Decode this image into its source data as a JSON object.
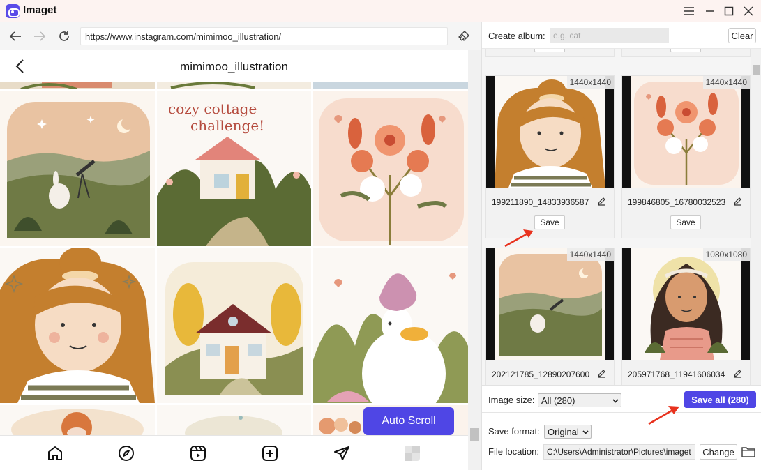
{
  "app": {
    "title": "Imaget"
  },
  "browser": {
    "url": "https://www.instagram.com/mimimoo_illustration/"
  },
  "instagram": {
    "profile_name": "mimimoo_illustration",
    "grid_texts": {
      "cozy_line1": "cozy cottage",
      "cozy_line2": "challenge!"
    },
    "auto_scroll_label": "Auto Scroll",
    "bottom_nav": [
      "home-icon",
      "explore-icon",
      "reels-icon",
      "create-icon",
      "direct-icon",
      "profile-icon"
    ]
  },
  "panel": {
    "album_label": "Create album:",
    "album_placeholder": "e.g. cat",
    "clear_label": "Clear",
    "save_label": "Save",
    "cards": [
      {
        "name": "199211890_14833936587",
        "size": "1440x1440"
      },
      {
        "name": "199846805_16780032523",
        "size": "1440x1440"
      },
      {
        "name": "202121785_12890207600",
        "size": "1440x1440"
      },
      {
        "name": "205971768_11941606034",
        "size": "1080x1080"
      }
    ],
    "image_size_label": "Image size:",
    "image_size_value": "All (280)",
    "save_all_label": "Save all (280)",
    "save_format_label": "Save format:",
    "save_format_value": "Original",
    "file_location_label": "File location:",
    "file_location_value": "C:\\Users\\Administrator\\Pictures\\imaget",
    "change_label": "Change"
  },
  "colors": {
    "accent": "#4f46e5",
    "arrow": "#e8321e"
  }
}
